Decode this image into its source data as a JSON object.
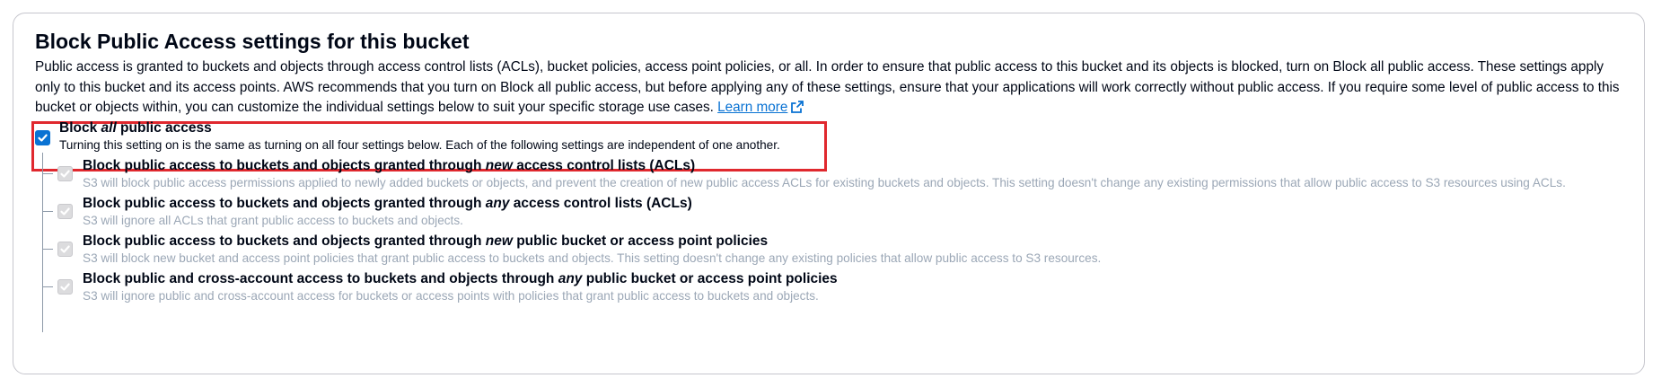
{
  "section": {
    "title": "Block Public Access settings for this bucket",
    "description": "Public access is granted to buckets and objects through access control lists (ACLs), bucket policies, access point policies, or all. In order to ensure that public access to this bucket and its objects is blocked, turn on Block all public access. These settings apply only to this bucket and its access points. AWS recommends that you turn on Block all public access, but before applying any of these settings, ensure that your applications will work correctly without public access. If you require some level of public access to this bucket or objects within, you can customize the individual settings below to suit your specific storage use cases.",
    "learn_more": "Learn more",
    "learn_more_icon": "external-link-icon",
    "highlight_color": "#e0282e",
    "accent_color": "#0972d3"
  },
  "block_all": {
    "label_pre": "Block ",
    "label_em": "all",
    "label_post": " public access",
    "description": "Turning this setting on is the same as turning on all four settings below. Each of the following settings are independent of one another.",
    "checked": true
  },
  "settings": [
    {
      "label_pre": "Block public access to buckets and objects granted through ",
      "label_em": "new",
      "label_post": " access control lists (ACLs)",
      "description": "S3 will block public access permissions applied to newly added buckets or objects, and prevent the creation of new public access ACLs for existing buckets and objects. This setting doesn't change any existing permissions that allow public access to S3 resources using ACLs.",
      "checked": true,
      "disabled": true
    },
    {
      "label_pre": "Block public access to buckets and objects granted through ",
      "label_em": "any",
      "label_post": " access control lists (ACLs)",
      "description": "S3 will ignore all ACLs that grant public access to buckets and objects.",
      "checked": true,
      "disabled": true
    },
    {
      "label_pre": "Block public access to buckets and objects granted through ",
      "label_em": "new",
      "label_post": " public bucket or access point policies",
      "description": "S3 will block new bucket and access point policies that grant public access to buckets and objects. This setting doesn't change any existing policies that allow public access to S3 resources.",
      "checked": true,
      "disabled": true
    },
    {
      "label_pre": "Block public and cross-account access to buckets and objects through ",
      "label_em": "any",
      "label_post": " public bucket or access point policies",
      "description": "S3 will ignore public and cross-account access for buckets or access points with policies that grant public access to buckets and objects.",
      "checked": true,
      "disabled": true
    }
  ]
}
